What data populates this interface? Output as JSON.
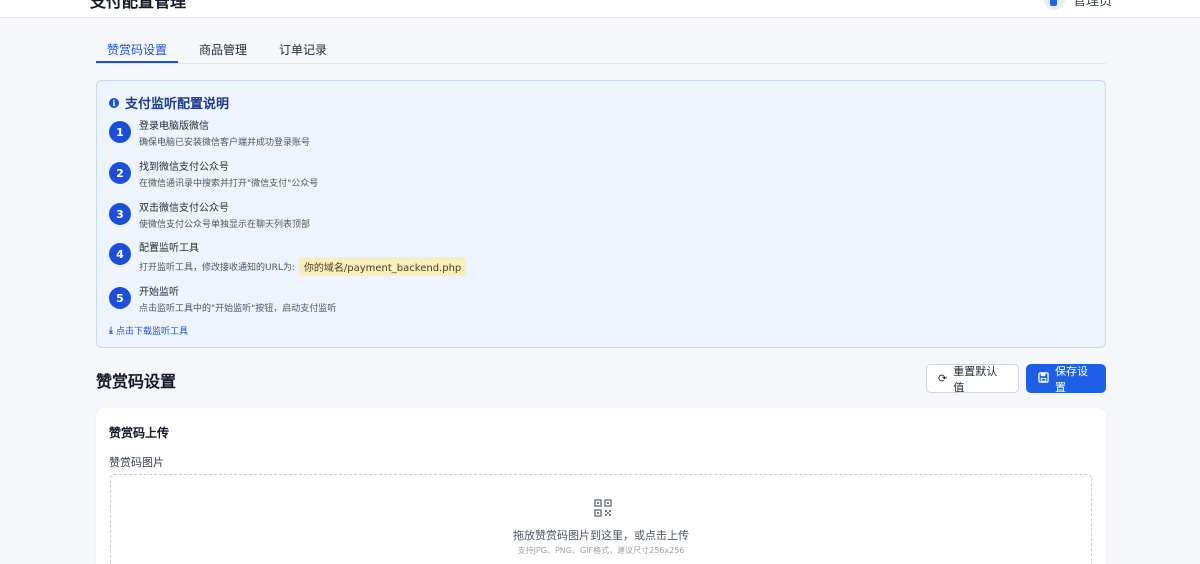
{
  "header": {
    "title": "支付配置管理",
    "user_label": "管理员"
  },
  "tabs": [
    {
      "label": "赞赏码设置",
      "active": true
    },
    {
      "label": "商品管理",
      "active": false
    },
    {
      "label": "订单记录",
      "active": false
    }
  ],
  "info": {
    "title": "支付监听配置说明",
    "steps": [
      {
        "num": "1",
        "title": "登录电脑版微信",
        "desc": "确保电脑已安装微信客户端并成功登录账号"
      },
      {
        "num": "2",
        "title": "找到微信支付公众号",
        "desc": "在微信通讯录中搜索并打开\"微信支付\"公众号"
      },
      {
        "num": "3",
        "title": "双击微信支付公众号",
        "desc": "使微信支付公众号单独显示在聊天列表顶部"
      },
      {
        "num": "4",
        "title": "配置监听工具",
        "desc": "打开监听工具，修改接收通知的URL为:",
        "code": "你的域名/payment_backend.php"
      },
      {
        "num": "5",
        "title": "开始监听",
        "desc": "点击监听工具中的\"开始监听\"按钮，启动支付监听"
      }
    ],
    "download_label": "点击下载监听工具"
  },
  "section": {
    "title": "赞赏码设置",
    "reset_label": "重置默认值",
    "save_label": "保存设置"
  },
  "upload": {
    "card_title": "赞赏码上传",
    "field_label": "赞赏码图片",
    "drop_text": "拖放赞赏码图片到这里，或点击上传",
    "drop_hint": "支持JPG、PNG、GIF格式，建议尺寸256x256"
  },
  "colors": {
    "accent": "#1d5fe6",
    "info_bg": "#eef4fd",
    "code_bg": "#fbeebd"
  }
}
